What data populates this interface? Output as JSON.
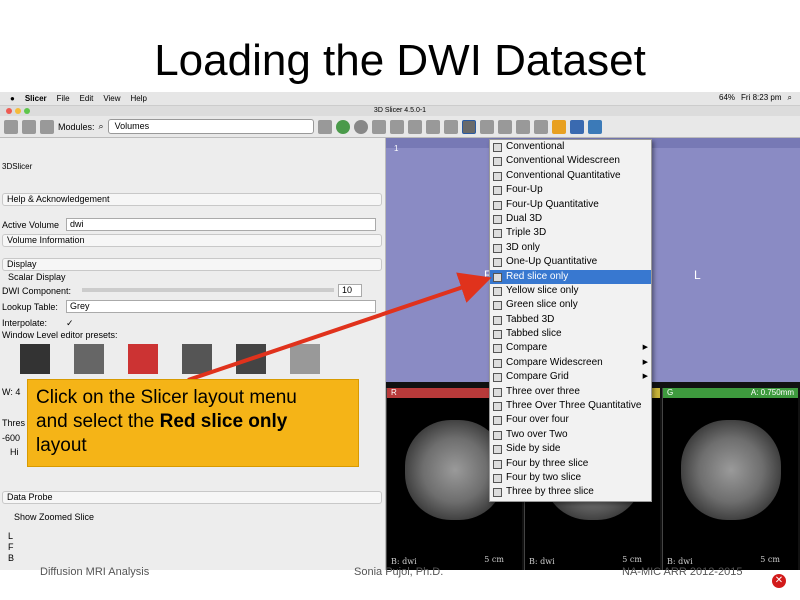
{
  "slide": {
    "title": "Loading the DWI Dataset",
    "footer_left": "Diffusion MRI Analysis",
    "footer_center": "Sonia Pujol, Ph.D.",
    "footer_right": "NA-MIC ARR 2012-2015"
  },
  "mac_menubar": {
    "app": "Slicer",
    "items": [
      "File",
      "Edit",
      "View",
      "Help"
    ],
    "battery": "64%",
    "clock": "Fri 8:23 pm"
  },
  "window": {
    "title": "3D Slicer 4.5.0-1"
  },
  "toolbar": {
    "modules_label": "Modules:",
    "modules_value": "Volumes"
  },
  "left_panel": {
    "logo": "3DSlicer",
    "help_section": "Help & Acknowledgement",
    "active_volume_label": "Active Volume",
    "active_volume_value": "dwi",
    "volume_info_section": "Volume Information",
    "display_section": "Display",
    "scalar_display_section": "Scalar Display",
    "dwi_component_label": "DWI Component:",
    "dwi_component_value": "10",
    "lookup_table_label": "Lookup Table:",
    "lookup_table_value": "Grey",
    "interpolate_label": "Interpolate:",
    "interpolate_value": "✓",
    "wl_presets_label": "Window Level editor presets:",
    "w_label": "W: 4",
    "thres_label": "Thres",
    "thres_value": "-600",
    "hi_label": "Hi",
    "data_probe_section": "Data Probe",
    "show_zoomed_label": "Show Zoomed Slice",
    "probe_letters": [
      "L",
      "F",
      "B"
    ]
  },
  "viewer": {
    "view3d_number": "1",
    "orientation_r": "R",
    "orientation_l": "L",
    "slices": [
      {
        "name": "R",
        "color": "#b83a3a",
        "volume": "B: dwi",
        "scale": "5 cm",
        "extra": "S:"
      },
      {
        "name": "Y",
        "color": "#c8b33a",
        "volume": "B: dwi",
        "scale": "5 cm",
        "extra": ""
      },
      {
        "name": "G",
        "color": "#3e9a3e",
        "volume": "B: dwi",
        "scale": "5 cm",
        "extra": "A: 0.750mm"
      }
    ]
  },
  "layout_menu": {
    "items": [
      {
        "label": "Conventional"
      },
      {
        "label": "Conventional Widescreen"
      },
      {
        "label": "Conventional Quantitative"
      },
      {
        "label": "Four-Up"
      },
      {
        "label": "Four-Up Quantitative"
      },
      {
        "label": "Dual 3D"
      },
      {
        "label": "Triple 3D"
      },
      {
        "label": "3D only"
      },
      {
        "label": "One-Up Quantitative"
      },
      {
        "label": "Red slice only",
        "selected": true
      },
      {
        "label": "Yellow slice only"
      },
      {
        "label": "Green slice only"
      },
      {
        "label": "Tabbed 3D"
      },
      {
        "label": "Tabbed slice"
      },
      {
        "label": "Compare",
        "submenu": true
      },
      {
        "label": "Compare Widescreen",
        "submenu": true
      },
      {
        "label": "Compare Grid",
        "submenu": true
      },
      {
        "label": "Three over three"
      },
      {
        "label": "Three Over Three Quantitative"
      },
      {
        "label": "Four over four"
      },
      {
        "label": "Two over Two"
      },
      {
        "label": "Side by side"
      },
      {
        "label": "Four by three slice"
      },
      {
        "label": "Four by two slice"
      },
      {
        "label": "Three by three slice"
      }
    ]
  },
  "callout": {
    "line1": "Click on the Slicer layout menu",
    "line2_prefix": "and select the ",
    "line2_bold": "Red slice only",
    "line3": "layout"
  },
  "colors": {
    "callout_bg": "#f5b417",
    "arrow": "#e0321c",
    "menu_highlight": "#3878d0",
    "view3d_bg": "#8a8bc4"
  }
}
